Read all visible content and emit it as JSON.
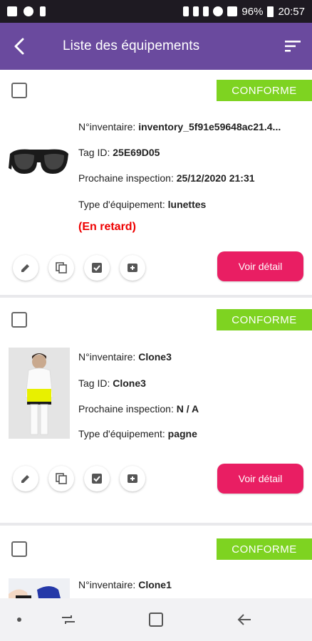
{
  "status_bar": {
    "battery": "96%",
    "time": "20:57"
  },
  "header": {
    "title": "Liste des équipements"
  },
  "colors": {
    "appbar": "#6a4a9e",
    "badge": "#7ed321",
    "detail_button": "#e91e63",
    "late_text": "#e00000"
  },
  "labels": {
    "inventory": "N°inventaire: ",
    "tag": "Tag ID: ",
    "next_inspection": "Prochaine inspection: ",
    "type": "Type d'équipement: ",
    "detail_button": "Voir détail"
  },
  "equipment": [
    {
      "status": "CONFORME",
      "inventory": "inventory_5f91e59648ac21.4...",
      "tag_id": "25E69D05",
      "next_inspection": "25/12/2020 21:31",
      "type": "lunettes",
      "late": "(En retard)",
      "image": "glasses-image"
    },
    {
      "status": "CONFORME",
      "inventory": "Clone3",
      "tag_id": "Clone3",
      "next_inspection": "N / A",
      "type": "pagne",
      "image": "apron-person-image"
    },
    {
      "status": "CONFORME",
      "inventory": "Clone1",
      "image": "gloves-image"
    }
  ],
  "actions": [
    "edit-icon",
    "copy-icon",
    "checkbox-checked-icon",
    "archive-icon"
  ]
}
